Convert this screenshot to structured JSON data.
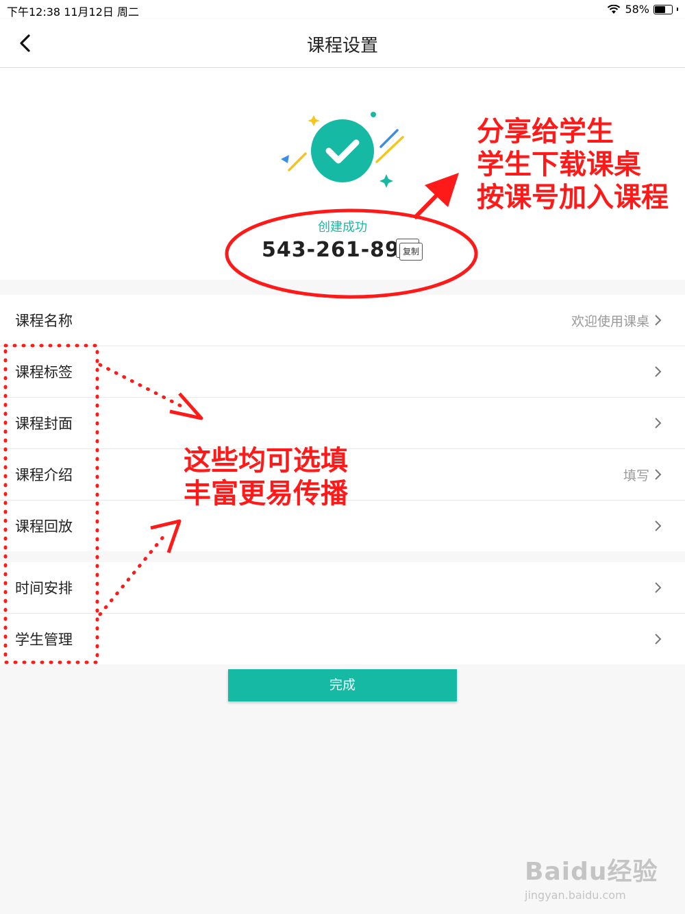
{
  "status_bar": {
    "time": "下午12:38   11月12日 周二",
    "battery": "58%"
  },
  "nav": {
    "title": "课程设置"
  },
  "hero": {
    "created_label": "创建成功",
    "course_code": "543-261-897",
    "copy_label": "复制"
  },
  "settings_a": [
    {
      "label": "课程名称",
      "value": "欢迎使用课桌"
    },
    {
      "label": "课程标签",
      "value": ""
    },
    {
      "label": "课程封面",
      "value": ""
    },
    {
      "label": "课程介绍",
      "value": "填写"
    },
    {
      "label": "课程回放",
      "value": ""
    }
  ],
  "settings_b": [
    {
      "label": "时间安排",
      "value": ""
    },
    {
      "label": "学生管理",
      "value": ""
    }
  ],
  "done_label": "完成",
  "annotations": {
    "share_lines": [
      "分享给学生",
      "学生下载课桌",
      "按课号加入课程"
    ],
    "optional_lines": [
      "这些均可选填",
      "丰富更易传播"
    ]
  },
  "watermark": {
    "main": "Baidu经验",
    "sub": "jingyan.baidu.com"
  },
  "colors": {
    "accent": "#16b9a4",
    "annotation": "#ff1a1a"
  }
}
